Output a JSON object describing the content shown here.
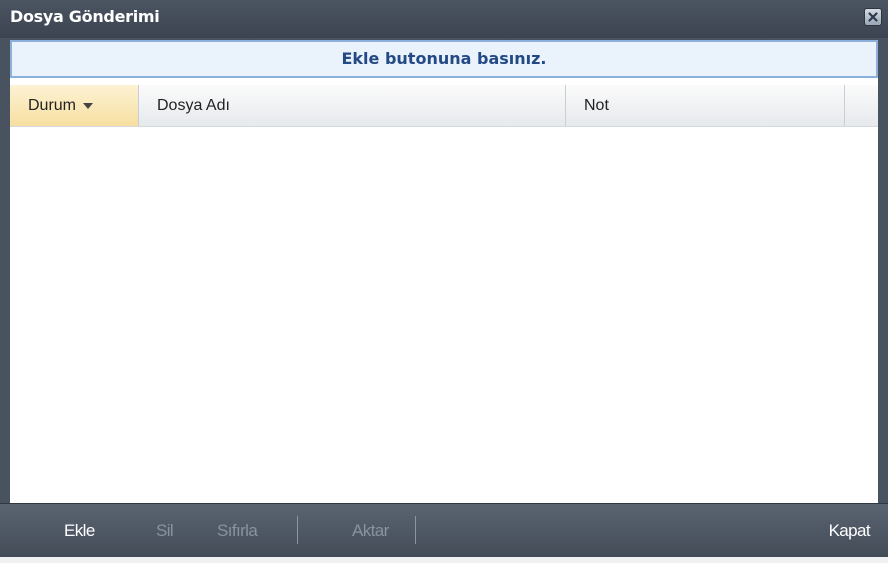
{
  "window": {
    "title": "Dosya Gönderimi",
    "close_icon": "close-icon"
  },
  "banner": {
    "text": "Ekle butonuna basınız."
  },
  "grid": {
    "columns": [
      {
        "label": "Durum",
        "sorted": true
      },
      {
        "label": "Dosya Adı"
      },
      {
        "label": "Not"
      },
      {
        "label": ""
      }
    ],
    "rows": []
  },
  "toolbar": {
    "add_label": "Ekle",
    "delete_label": "Sil",
    "reset_label": "Sıfırla",
    "transfer_label": "Aktar",
    "close_label": "Kapat"
  },
  "colors": {
    "titlebar": "#3b4450",
    "banner_text": "#244a86",
    "sorted_column": "#f6dfa1"
  }
}
